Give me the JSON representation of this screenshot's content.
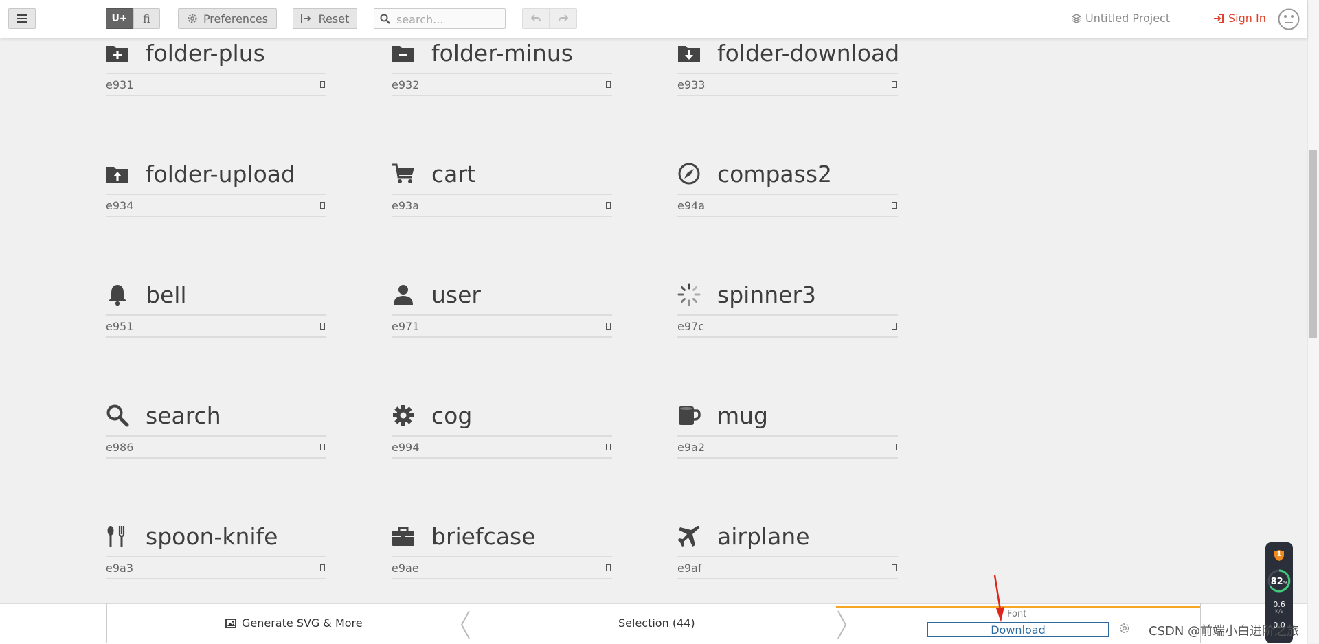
{
  "toolbar": {
    "seg_unicode": "U+",
    "seg_ligature": "fi",
    "preferences_label": "Preferences",
    "reset_label": "Reset",
    "search_placeholder": "search...",
    "project_label": "Untitled Project",
    "signin_label": "Sign In"
  },
  "glyphs": [
    {
      "name": "folder-plus",
      "code": "e931",
      "icon": "folder-plus-icon"
    },
    {
      "name": "folder-minus",
      "code": "e932",
      "icon": "folder-minus-icon"
    },
    {
      "name": "folder-download",
      "code": "e933",
      "icon": "folder-download-icon"
    },
    {
      "name": "folder-upload",
      "code": "e934",
      "icon": "folder-upload-icon"
    },
    {
      "name": "cart",
      "code": "e93a",
      "icon": "cart-icon"
    },
    {
      "name": "compass2",
      "code": "e94a",
      "icon": "compass-icon"
    },
    {
      "name": "bell",
      "code": "e951",
      "icon": "bell-icon"
    },
    {
      "name": "user",
      "code": "e971",
      "icon": "user-icon"
    },
    {
      "name": "spinner3",
      "code": "e97c",
      "icon": "spinner-icon"
    },
    {
      "name": "search",
      "code": "e986",
      "icon": "search-icon"
    },
    {
      "name": "cog",
      "code": "e994",
      "icon": "cog-icon"
    },
    {
      "name": "mug",
      "code": "e9a2",
      "icon": "mug-icon"
    },
    {
      "name": "spoon-knife",
      "code": "e9a3",
      "icon": "spoon-knife-icon"
    },
    {
      "name": "briefcase",
      "code": "e9ae",
      "icon": "briefcase-icon"
    },
    {
      "name": "airplane",
      "code": "e9af",
      "icon": "airplane-icon"
    }
  ],
  "bottombar": {
    "generate_label": "Generate SVG & More",
    "selection_label": "Selection (44)",
    "font_label": "Font",
    "download_label": "Download"
  },
  "overlay": {
    "badge": "1",
    "cpu_value": "82",
    "cpu_unit": "%",
    "net_up": "0.6",
    "net_unit": "K/s",
    "net_down": "0.0"
  },
  "watermark": "CSDN @前端小白进阶之旅",
  "colors": {
    "accent_red": "#e0412c",
    "font_tab_accent": "#f5a623",
    "download_blue": "#2c6aa0"
  }
}
